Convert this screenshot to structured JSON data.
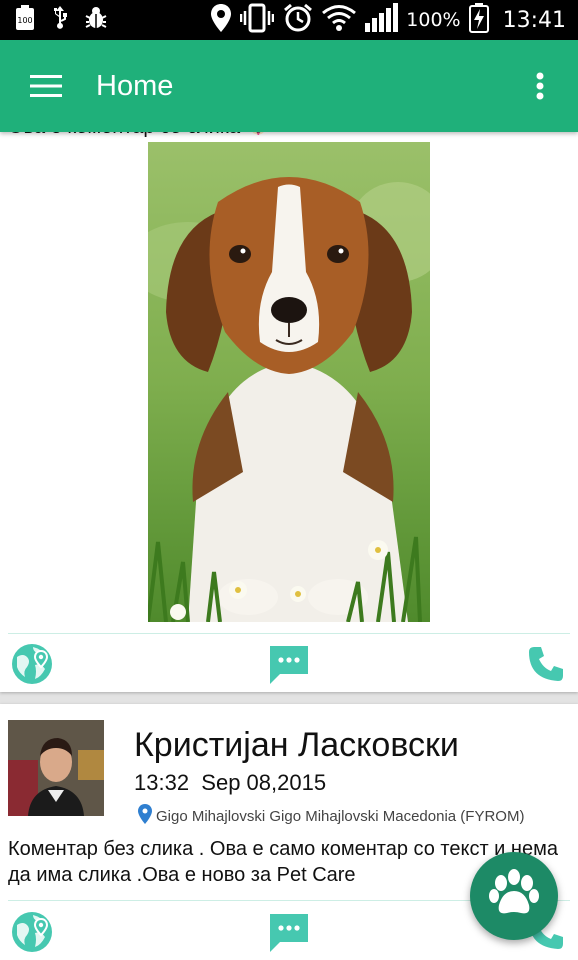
{
  "status_bar": {
    "battery_percent": "100%",
    "time": "13:41",
    "battery_level_icon_text": "100"
  },
  "app_bar": {
    "title": "Home"
  },
  "posts": [
    {
      "comment": "Ова е коментар со слика 🐶",
      "image_alt": "beagle puppy photo"
    },
    {
      "user_name": "Кристијан Ласковски",
      "time": "13:32",
      "date": "Sep 08,2015",
      "location": "Gigo Mihajlovski Gigo Mihajlovski Macedonia (FYROM)",
      "comment": "Коментар без слика . Ова е само коментар со текст и нема да има слика .Ова е ново за Pet Care"
    }
  ],
  "colors": {
    "primary": "#1fb07a",
    "accent": "#46c8b0",
    "fab": "#1d8a66"
  }
}
